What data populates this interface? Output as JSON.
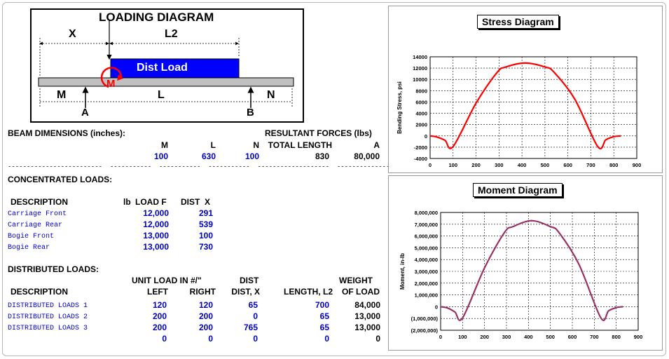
{
  "loading_diagram": {
    "title": "LOADING DIAGRAM",
    "label_x": "X",
    "label_l2": "L2",
    "dist_load": "Dist Load",
    "label_m_moment": "M",
    "label_m": "M",
    "label_l": "L",
    "label_n": "N",
    "label_a": "A",
    "label_b": "B"
  },
  "beam": {
    "heading": "BEAM DIMENSIONS (inches):",
    "col_m": "M",
    "col_l": "L",
    "col_n": "N",
    "val_m": "100",
    "val_l": "630",
    "val_n": "100"
  },
  "resultants": {
    "heading": "RESULTANT FORCES (lbs)",
    "col_total": "TOTAL LENGTH",
    "col_a": "A",
    "val_total": "830",
    "val_a": "80,000"
  },
  "conc": {
    "heading": "CONCENTRATED LOADS:",
    "col_desc": "DESCRIPTION",
    "col_lb": "lb",
    "col_load": "LOAD F",
    "col_dist": "DIST  X",
    "rows": [
      {
        "desc": "Carriage Front",
        "load": "12,000",
        "dist": "291"
      },
      {
        "desc": "Carriage Rear",
        "load": "12,000",
        "dist": "539"
      },
      {
        "desc": "Bogie Front",
        "load": "13,000",
        "dist": "100"
      },
      {
        "desc": "Bogie Rear",
        "load": "13,000",
        "dist": "730"
      }
    ]
  },
  "dist": {
    "heading": "DISTRIBUTED LOADS:",
    "h_unit": "UNIT LOAD IN #/\"",
    "h_dist": "DIST",
    "h_weight": "WEIGHT",
    "col_desc": "DESCRIPTION",
    "col_left": "LEFT",
    "col_right": "RIGHT",
    "col_distx": "DIST, X",
    "col_len": "LENGTH, L2",
    "col_of": "OF LOAD",
    "rows": [
      {
        "desc": "DISTRIBUTED LOADS 1",
        "left": "120",
        "right": "120",
        "dist": "65",
        "len": "700",
        "weight": "84,000"
      },
      {
        "desc": "DISTRIBUTED LOADS 2",
        "left": "200",
        "right": "200",
        "dist": "0",
        "len": "65",
        "weight": "13,000"
      },
      {
        "desc": "DISTRIBUTED LOADS 3",
        "left": "200",
        "right": "200",
        "dist": "765",
        "len": "65",
        "weight": "13,000"
      },
      {
        "desc": "",
        "left": "0",
        "right": "0",
        "dist": "0",
        "len": "0",
        "weight": "0"
      }
    ]
  },
  "dash_row": "-------------------------  -----------  -----------  -----------  -------------------  --------------",
  "chart_data": [
    {
      "type": "line",
      "title": "Stress Diagram",
      "xlabel": "",
      "ylabel": "Bending Stress, psi",
      "xlim": [
        0,
        900
      ],
      "ylim": [
        -4000,
        14000
      ],
      "x_ticks": [
        "0",
        "100",
        "200",
        "300",
        "400",
        "500",
        "600",
        "700",
        "800",
        "900"
      ],
      "y_ticks": [
        "-4000",
        "-2000",
        "0",
        "2000",
        "4000",
        "6000",
        "8000",
        "10000",
        "12000",
        "14000"
      ],
      "grid": true,
      "color": "#ff0000",
      "x": [
        0,
        30,
        65,
        100,
        200,
        291,
        330,
        415,
        500,
        539,
        630,
        730,
        765,
        800,
        830
      ],
      "y": [
        0,
        -200,
        -800,
        -1900,
        5800,
        11200,
        12200,
        12900,
        12200,
        11300,
        6500,
        -1900,
        -700,
        -150,
        0
      ]
    },
    {
      "type": "line",
      "title": "Moment Diagram",
      "xlabel": "",
      "ylabel": "Moment, in-lb",
      "xlim": [
        0,
        900
      ],
      "ylim": [
        -2000000,
        8000000
      ],
      "x_ticks": [
        "0",
        "100",
        "200",
        "300",
        "400",
        "500",
        "600",
        "700",
        "800",
        "900"
      ],
      "y_ticks": [
        "(2,000,000)",
        "(1,000,000)",
        "0",
        "1,000,000",
        "2,000,000",
        "3,000,000",
        "4,000,000",
        "5,000,000",
        "6,000,000",
        "7,000,000",
        "8,000,000"
      ],
      "grid": true,
      "color": "#993366",
      "x": [
        0,
        30,
        65,
        100,
        200,
        291,
        330,
        415,
        500,
        539,
        630,
        730,
        765,
        800,
        830
      ],
      "y": [
        0,
        -100000,
        -450000,
        -950000,
        3300000,
        6300000,
        6800000,
        7300000,
        6800000,
        6300000,
        3600000,
        -950000,
        -350000,
        -80000,
        0
      ]
    }
  ]
}
